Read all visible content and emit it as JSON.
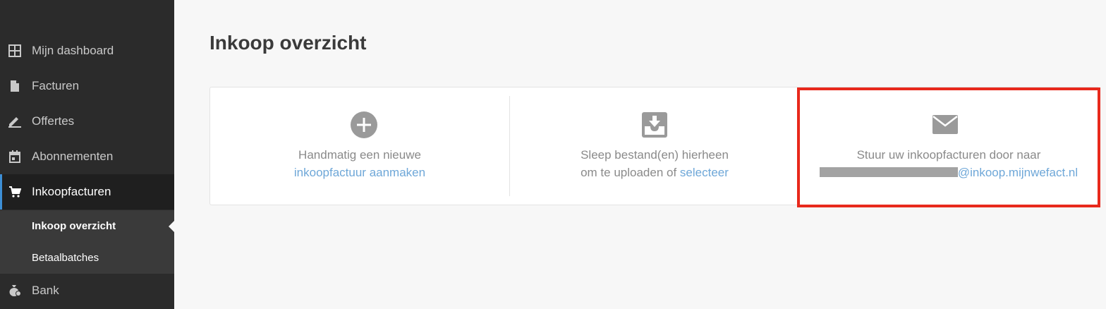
{
  "sidebar": {
    "items": [
      {
        "label": "Mijn dashboard",
        "icon": "dashboard-grid-icon"
      },
      {
        "label": "Facturen",
        "icon": "document-icon"
      },
      {
        "label": "Offertes",
        "icon": "pencil-icon"
      },
      {
        "label": "Abonnementen",
        "icon": "calendar-icon"
      },
      {
        "label": "Inkoopfacturen",
        "icon": "shopping-cart-icon",
        "active": true
      },
      {
        "label": "Bank",
        "icon": "money-bag-icon"
      }
    ],
    "submenu": [
      {
        "label": "Inkoop overzicht",
        "active": true
      },
      {
        "label": "Betaalbatches"
      }
    ]
  },
  "main": {
    "title": "Inkoop overzicht",
    "panels": {
      "manual": {
        "icon": "plus-circle-icon",
        "line1": "Handmatig een nieuwe",
        "link": "inkoopfactuur aanmaken"
      },
      "upload": {
        "icon": "inbox-download-icon",
        "line1": "Sleep bestand(en) hierheen",
        "line2_prefix": "om te uploaden of",
        "link": "selecteer"
      },
      "email": {
        "icon": "envelope-icon",
        "line1": "Stuur uw inkoopfacturen door naar",
        "email_domain": "@inkoop.mijnwefact.nl"
      }
    }
  },
  "colors": {
    "sidebar_bg": "#2b2b2b",
    "active_indicator": "#3d8fd6",
    "link": "#6ea7d8",
    "highlight_border": "#e8291c"
  }
}
